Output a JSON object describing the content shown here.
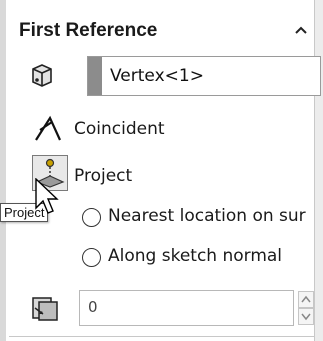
{
  "panel": {
    "title": "First Reference",
    "collapse_icon": "chevron-up-icon"
  },
  "reference": {
    "icon": "cube-icon",
    "value": "Vertex<1>",
    "swatch_color": "#8c8c8c"
  },
  "relations": {
    "coincident": {
      "icon": "coincident-icon",
      "label": "Coincident"
    },
    "project": {
      "icon": "project-icon",
      "label": "Project",
      "tooltip": "Project"
    }
  },
  "project_options": [
    {
      "label": "Nearest location on sur",
      "selected": false
    },
    {
      "label": "Along sketch normal",
      "selected": false
    }
  ],
  "offset": {
    "icon": "distance-icon",
    "value": "0"
  }
}
